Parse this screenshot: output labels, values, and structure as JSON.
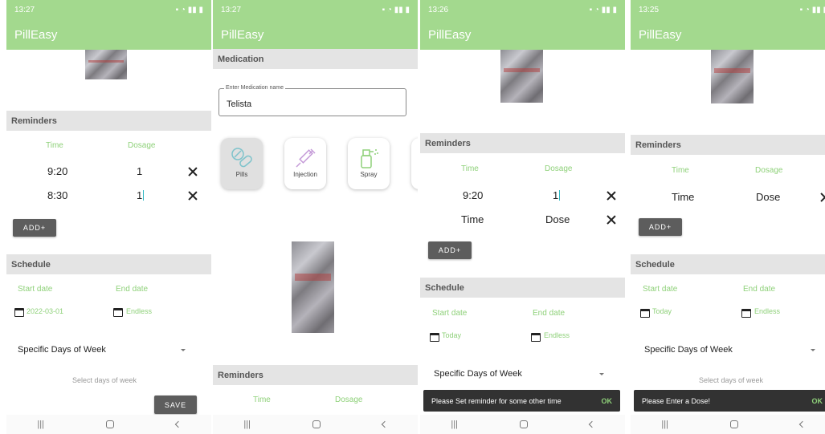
{
  "screens": [
    {
      "status_time": "13:27",
      "app_title": "PillEasy",
      "reminders_title": "Reminders",
      "time_header": "Time",
      "dosage_header": "Dosage",
      "rows": [
        {
          "time": "9:20",
          "dose": "1"
        },
        {
          "time": "8:30",
          "dose": "1"
        }
      ],
      "add_button": "ADD+",
      "schedule_title": "Schedule",
      "start_label": "Start date",
      "end_label": "End date",
      "start_value": "2022-03-01",
      "end_value": "Endless",
      "frequency": "Specific Days of Week",
      "days_hint": "Select days of week",
      "save_button": "SAVE"
    },
    {
      "status_time": "13:27",
      "app_title": "PillEasy",
      "medication_title": "Medication",
      "name_label": "Enter Medication name",
      "name_value": "Telista",
      "types": [
        "Pills",
        "Injection",
        "Spray"
      ],
      "reminders_title": "Reminders",
      "time_header": "Time",
      "dosage_header": "Dosage"
    },
    {
      "status_time": "13:26",
      "app_title": "PillEasy",
      "reminders_title": "Reminders",
      "time_header": "Time",
      "dosage_header": "Dosage",
      "rows": [
        {
          "time": "9:20",
          "dose": "1"
        },
        {
          "time": "Time",
          "dose": "Dose"
        }
      ],
      "add_button": "ADD+",
      "schedule_title": "Schedule",
      "start_label": "Start date",
      "end_label": "End date",
      "start_value": "Today",
      "end_value": "Endless",
      "frequency": "Specific Days of Week",
      "snackbar_text": "Please Set reminder for some other time",
      "snackbar_action": "OK"
    },
    {
      "status_time": "13:25",
      "app_title": "PillEasy",
      "reminders_title": "Reminders",
      "time_header": "Time",
      "dosage_header": "Dosage",
      "rows": [
        {
          "time": "Time",
          "dose": "Dose"
        }
      ],
      "add_button": "ADD+",
      "schedule_title": "Schedule",
      "start_label": "Start date",
      "end_label": "End date",
      "start_value": "Today",
      "end_value": "Endless",
      "frequency": "Specific Days of Week",
      "days_hint": "Select days of week",
      "snackbar_text": "Please Enter a Dose!",
      "snackbar_action": "OK"
    }
  ],
  "icons": [
    "close-icon",
    "calendar-icon",
    "dropdown-caret-icon",
    "pill-icon",
    "syringe-icon",
    "spray-icon",
    "nav-recents-icon",
    "nav-home-icon",
    "nav-back-icon"
  ],
  "colors": {
    "accent": "#a3d98e",
    "accent_text": "#8fd17a",
    "section_bg": "#e4e4e4",
    "button_dark": "#5d5d5d",
    "snackbar_bg": "#323232"
  }
}
